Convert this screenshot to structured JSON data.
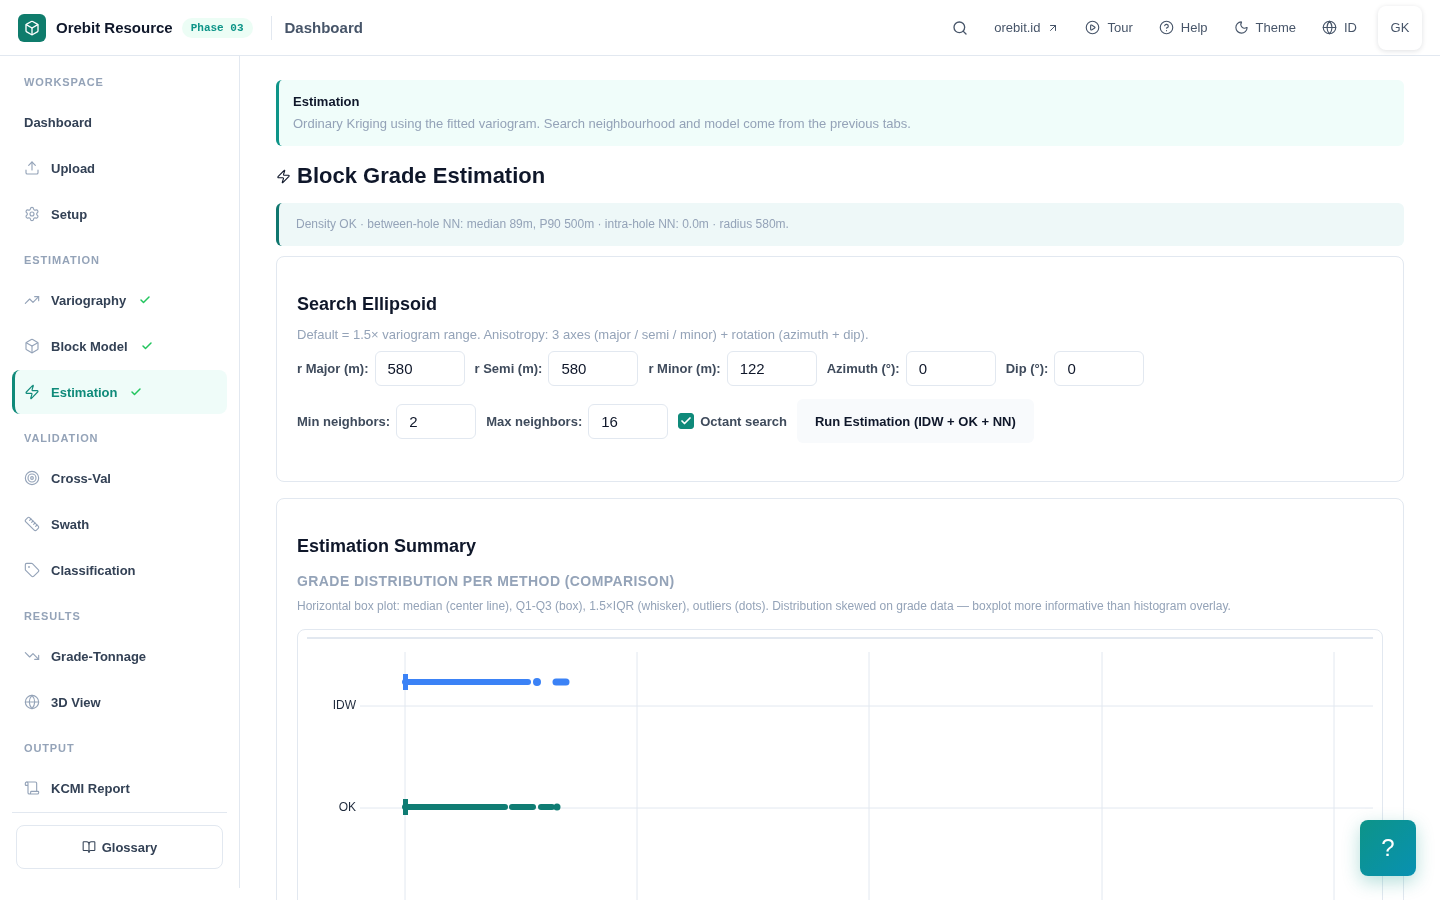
{
  "header": {
    "app_name": "Orebit Resource",
    "phase_badge": "Phase 03",
    "breadcrumb": "Dashboard",
    "actions": [
      {
        "kind": "link",
        "label": "orebit.id"
      },
      {
        "kind": "tour",
        "label": "Tour"
      },
      {
        "kind": "help",
        "label": "Help"
      },
      {
        "kind": "theme",
        "label": "Theme"
      },
      {
        "kind": "language",
        "label": "ID"
      }
    ],
    "user_initials": "GK"
  },
  "sidebar": {
    "sections": [
      {
        "title": "WORKSPACE",
        "items": [
          {
            "kind": "dashboard",
            "label": "Dashboard",
            "selected": false,
            "done": false
          },
          {
            "kind": "upload",
            "label": "Upload",
            "selected": false,
            "done": false
          },
          {
            "kind": "setup",
            "label": "Setup",
            "selected": false,
            "done": false
          }
        ]
      },
      {
        "title": "ESTIMATION",
        "items": [
          {
            "kind": "variography",
            "label": "Variography",
            "selected": false,
            "done": true
          },
          {
            "kind": "blockmodel",
            "label": "Block Model",
            "selected": false,
            "done": true
          },
          {
            "kind": "estimation",
            "label": "Estimation",
            "selected": true,
            "done": true
          }
        ]
      },
      {
        "title": "VALIDATION",
        "items": [
          {
            "kind": "crossval",
            "label": "Cross-Val",
            "selected": false,
            "done": false
          },
          {
            "kind": "swath",
            "label": "Swath",
            "selected": false,
            "done": false
          },
          {
            "kind": "classification",
            "label": "Classification",
            "selected": false,
            "done": false
          }
        ]
      },
      {
        "title": "RESULTS",
        "items": [
          {
            "kind": "gradetonnage",
            "label": "Grade-Tonnage",
            "selected": false,
            "done": false
          },
          {
            "kind": "view3d",
            "label": "3D View",
            "selected": false,
            "done": false
          }
        ]
      },
      {
        "title": "OUTPUT",
        "items": [
          {
            "kind": "report",
            "label": "KCMI Report",
            "selected": false,
            "done": false
          }
        ]
      }
    ],
    "glossary_button": "Glossary"
  },
  "intro_callout": {
    "title": "Estimation",
    "text": "Ordinary Kriging using the fitted variogram. Search neighbourhood and model come from the previous tabs."
  },
  "page_title": "Block Grade Estimation",
  "density_note": "Density OK · between-hole NN: median 89m, P90 500m · intra-hole NN: 0.0m · radius 580m.",
  "search_ellipsoid": {
    "title": "Search Ellipsoid",
    "description": "Default = 1.5× variogram range. Anisotropy: 3 axes (major / semi / minor) + rotation (azimuth + dip).",
    "fields": [
      {
        "label": "r Major (m):",
        "value": "580"
      },
      {
        "label": "r Semi (m):",
        "value": "580"
      },
      {
        "label": "r Minor (m):",
        "value": "122"
      },
      {
        "label": "Azimuth (°):",
        "value": "0"
      },
      {
        "label": "Dip (°):",
        "value": "0"
      }
    ],
    "neighbor_fields": [
      {
        "label": "Min neighbors:",
        "value": "2"
      },
      {
        "label": "Max neighbors:",
        "value": "16"
      }
    ],
    "octant_search": {
      "label": "Octant search",
      "checked": true
    },
    "run_button": "Run Estimation (IDW + OK + NN)"
  },
  "estimation_summary": {
    "title": "Estimation Summary",
    "chart_title": "GRADE DISTRIBUTION PER METHOD (COMPARISON)",
    "chart_caption": "Horizontal box plot: median (center line), Q1-Q3 (box), 1.5×IQR (whisker), outliers (dots). Distribution skewed on grade data — boxplot more informative than histogram overlay.",
    "boxplot": {
      "series": [
        {
          "name": "IDW",
          "color": "#3b82f6"
        },
        {
          "name": "OK",
          "color": "#0f7c73"
        }
      ]
    }
  },
  "help_button": "?"
}
